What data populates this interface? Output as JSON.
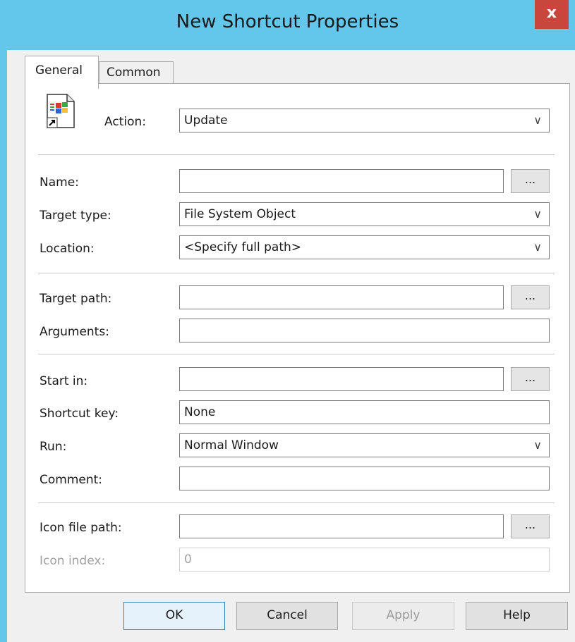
{
  "window": {
    "title": "New Shortcut Properties",
    "close_label": "x",
    "accent_color": "#62c7ea",
    "close_color": "#c9463d"
  },
  "tabs": [
    {
      "label": "General",
      "selected": true
    },
    {
      "label": "Common",
      "selected": false
    }
  ],
  "icons": {
    "shortcut": "windows-shortcut-icon",
    "dropdown": "chevron-down-icon",
    "close": "close-icon"
  },
  "form": {
    "action": {
      "label": "Action:",
      "value": "Update"
    },
    "name": {
      "label": "Name:",
      "value": "",
      "browse": "..."
    },
    "target_type": {
      "label": "Target type:",
      "value": "File System Object"
    },
    "location": {
      "label": "Location:",
      "value": "<Specify full path>"
    },
    "target_path": {
      "label": "Target path:",
      "value": "",
      "browse": "..."
    },
    "arguments": {
      "label": "Arguments:",
      "value": ""
    },
    "start_in": {
      "label": "Start in:",
      "value": "",
      "browse": "..."
    },
    "shortcut_key": {
      "label": "Shortcut key:",
      "value": "None"
    },
    "run": {
      "label": "Run:",
      "value": "Normal Window"
    },
    "comment": {
      "label": "Comment:",
      "value": ""
    },
    "icon_file_path": {
      "label": "Icon file path:",
      "value": "",
      "browse": "..."
    },
    "icon_index": {
      "label": "Icon index:",
      "value": "0",
      "disabled": true
    }
  },
  "buttons": {
    "ok": "OK",
    "cancel": "Cancel",
    "apply": "Apply",
    "help": "Help"
  }
}
